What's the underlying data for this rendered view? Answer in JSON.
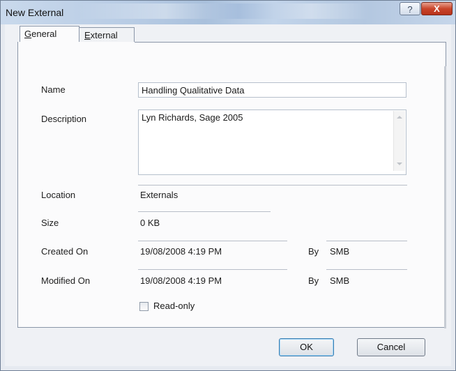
{
  "window": {
    "title": "New External",
    "help_glyph": "?",
    "close_glyph": "X"
  },
  "tabs": [
    {
      "label": "General",
      "accel": "G",
      "rest": "eneral",
      "selected": true
    },
    {
      "label": "External",
      "accel": "E",
      "rest": "xternal",
      "selected": false
    }
  ],
  "form": {
    "name_label": "Name",
    "name_value": "Handling Qualitative Data",
    "description_label": "Description",
    "description_value": "Lyn Richards, Sage 2005",
    "location_label": "Location",
    "location_value": "Externals",
    "size_label": "Size",
    "size_value": "0 KB",
    "created_label": "Created On",
    "created_value": "19/08/2008 4:19 PM",
    "created_by_label": "By",
    "created_by_value": "SMB",
    "modified_label": "Modified On",
    "modified_value": "19/08/2008 4:19 PM",
    "modified_by_label": "By",
    "modified_by_value": "SMB",
    "readonly_label": "Read-only",
    "readonly_checked": false
  },
  "buttons": {
    "ok": "OK",
    "cancel": "Cancel"
  }
}
